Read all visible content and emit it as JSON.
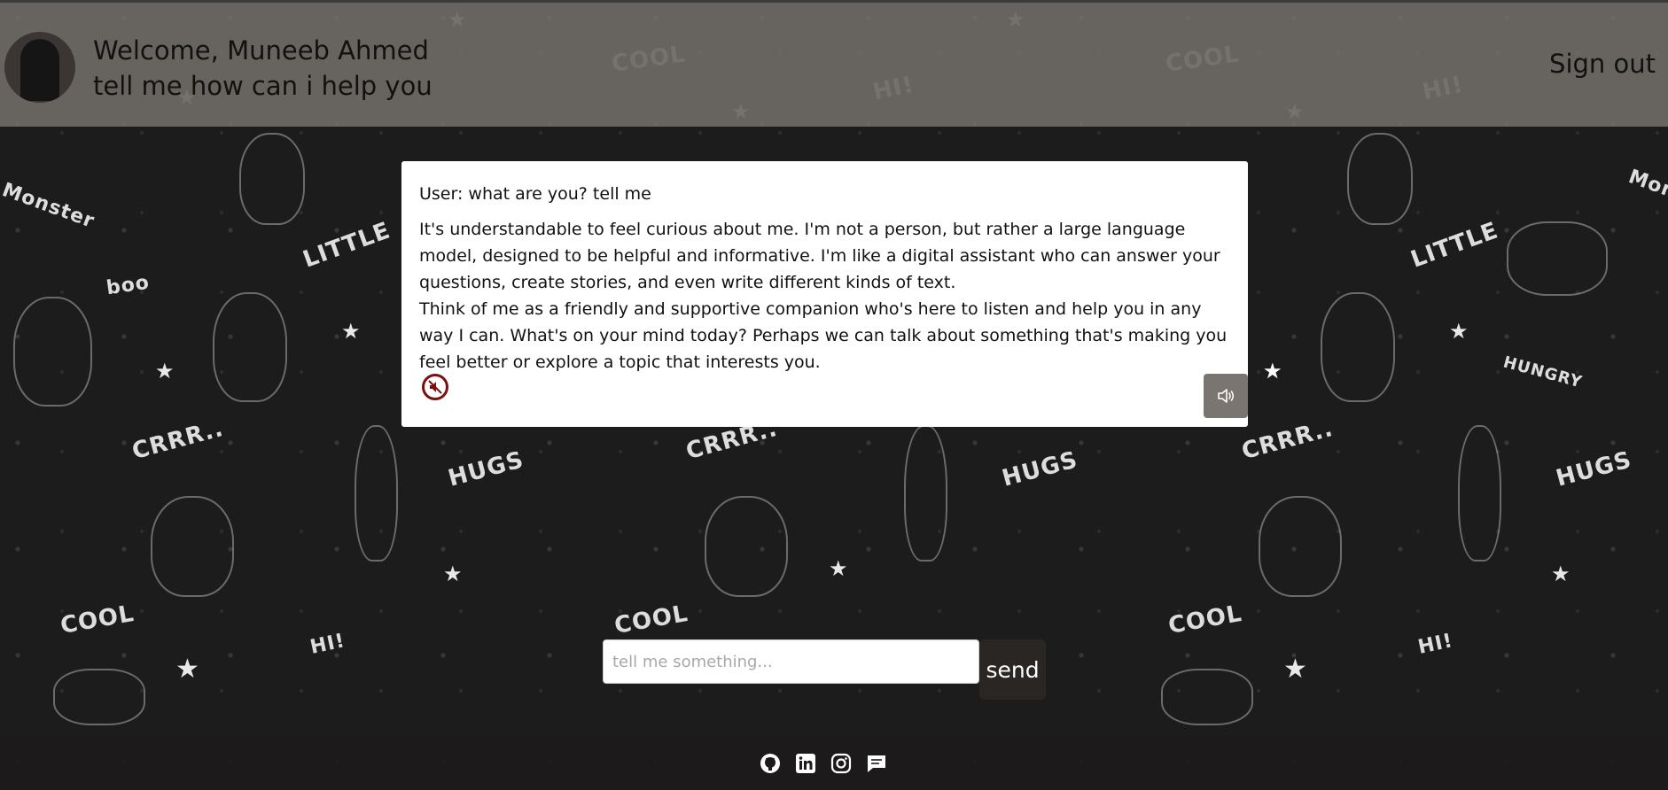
{
  "header": {
    "welcome_line": "Welcome, Muneeb Ahmed",
    "subtitle_line": "tell me how can i help you",
    "signout_label": "Sign out"
  },
  "chat": {
    "user_message": "User: what are you? tell me",
    "bot_paragraphs": [
      "It's understandable to feel curious about me. I'm not a person, but rather a large language model, designed to be helpful and informative. I'm like a digital assistant who can answer your questions, create stories, and even write different kinds of text.",
      "Think of me as a friendly and supportive companion who's here to listen and help you in any way I can. What's on your mind today? Perhaps we can talk about something that's making you feel better or explore a topic that interests you."
    ],
    "icons": {
      "mute": "mute-icon",
      "speaker": "speaker-icon"
    }
  },
  "composer": {
    "placeholder": "tell me something...",
    "value": "",
    "send_label": "send"
  },
  "footer": {
    "icons": [
      "github-icon",
      "linkedin-icon",
      "instagram-icon",
      "chat-icon"
    ]
  },
  "background": {
    "doodle_words": [
      "COOL",
      "HI!",
      "LITTLE",
      "boo",
      "CRRR..",
      "HUGS",
      "HUNGRY",
      "Monster"
    ]
  },
  "colors": {
    "header_bg": "#78736e",
    "page_bg": "#1c1c1c",
    "card_bg": "#ffffff",
    "send_bg": "#2a2624",
    "speaker_bg": "#7a7571"
  }
}
